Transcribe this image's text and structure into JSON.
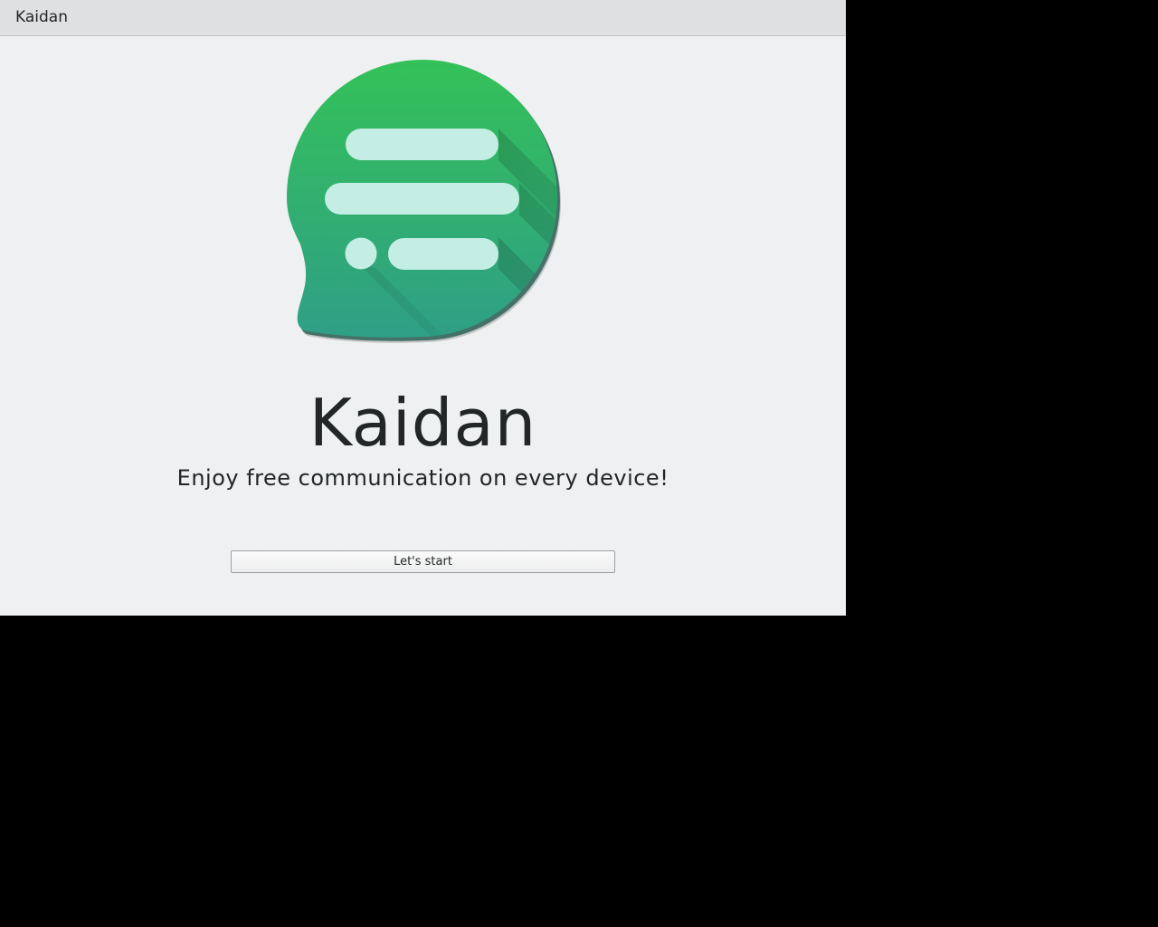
{
  "window": {
    "title": "Kaidan"
  },
  "start_page": {
    "logo_icon": "kaidan-chat-bubble-logo",
    "app_name": "Kaidan",
    "slogan": "Enjoy free communication on every device!",
    "start_button_label": "Let's start"
  },
  "colors": {
    "logo_green_top": "#34c158",
    "logo_green_bottom": "#2f9f86",
    "logo_lines": "#c4eee3",
    "background": "#eff0f1",
    "header": "#dfe0e2",
    "text": "#232627"
  }
}
